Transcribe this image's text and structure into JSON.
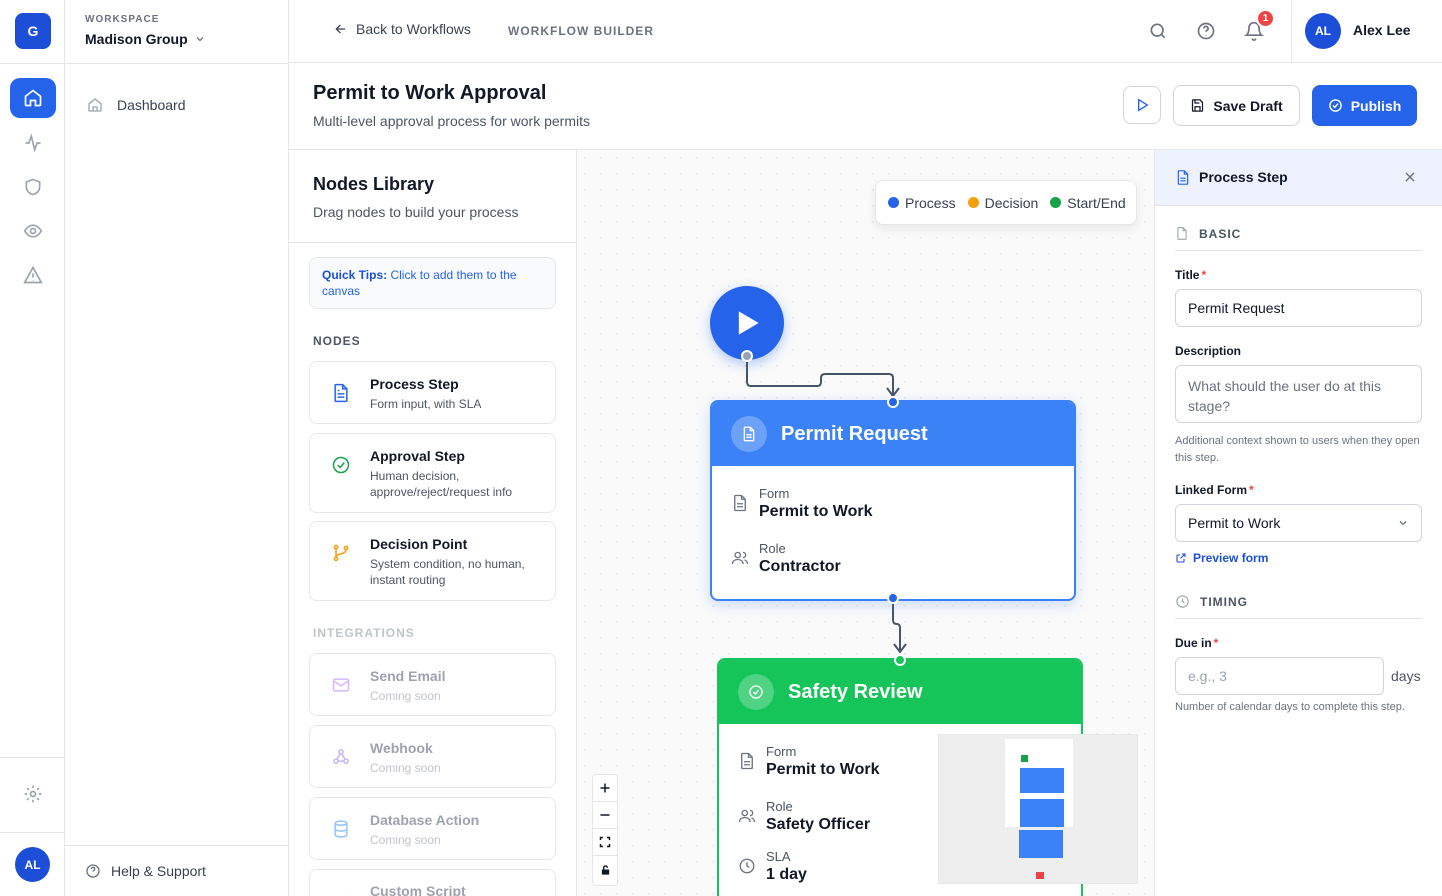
{
  "rail": {
    "logo_letter": "G",
    "avatar_initials": "AL",
    "items": [
      "home-icon",
      "activity-icon",
      "shield-icon",
      "eye-icon",
      "alert-triangle-icon"
    ],
    "settings_icon": "gear-icon"
  },
  "workspace": {
    "label": "WORKSPACE",
    "name": "Madison Group",
    "nav": [
      {
        "label": "Dashboard",
        "icon": "home-icon"
      }
    ],
    "help": "Help & Support"
  },
  "topbar": {
    "back_label": "Back to Workflows",
    "section_label": "WORKFLOW BUILDER",
    "notification_count": "1",
    "user": {
      "initials": "AL",
      "name": "Alex Lee"
    }
  },
  "header": {
    "title": "Permit to Work Approval",
    "subtitle": "Multi-level approval process for work permits",
    "save_label": "Save Draft",
    "publish_label": "Publish"
  },
  "library": {
    "title": "Nodes Library",
    "subtitle": "Drag nodes to build your process",
    "tips_title": "Quick Tips:",
    "tips_text": " Click to add them to the canvas",
    "nodes_label": "NODES",
    "nodes": [
      {
        "title": "Process Step",
        "desc": "Form input, with SLA",
        "icon": "document-icon"
      },
      {
        "title": "Approval Step",
        "desc": "Human decision, approve/reject/request info",
        "icon": "check-circle-icon"
      },
      {
        "title": "Decision Point",
        "desc": "System condition, no human, instant routing",
        "icon": "branch-icon"
      }
    ],
    "integrations_label": "INTEGRATIONS",
    "integrations": [
      {
        "title": "Send Email",
        "desc": "Coming soon",
        "icon": "mail-icon"
      },
      {
        "title": "Webhook",
        "desc": "Coming soon",
        "icon": "webhook-icon"
      },
      {
        "title": "Database Action",
        "desc": "Coming soon",
        "icon": "database-icon"
      },
      {
        "title": "Custom Script",
        "desc": "",
        "icon": "code-icon"
      }
    ]
  },
  "canvas": {
    "legend": [
      {
        "label": "Process",
        "color": "#2563eb"
      },
      {
        "label": "Decision",
        "color": "#f59e0b"
      },
      {
        "label": "Start/End",
        "color": "#16a34a"
      }
    ],
    "nodes": [
      {
        "title": "Permit Request",
        "color": "#3b82f6",
        "fields": [
          {
            "label": "Form",
            "value": "Permit to Work",
            "icon": "document-icon"
          },
          {
            "label": "Role",
            "value": "Contractor",
            "icon": "users-icon"
          }
        ]
      },
      {
        "title": "Safety Review",
        "color": "#16c55a",
        "fields": [
          {
            "label": "Form",
            "value": "Permit to Work",
            "icon": "document-icon"
          },
          {
            "label": "Role",
            "value": "Safety Officer",
            "icon": "users-icon"
          },
          {
            "label": "SLA",
            "value": "1 day",
            "icon": "clock-icon"
          }
        ]
      }
    ],
    "zoom_controls": [
      "+",
      "−",
      "fit",
      "lock"
    ]
  },
  "props": {
    "title": "Process Step",
    "basic_label": "BASIC",
    "title_label": "Title",
    "title_value": "Permit Request",
    "desc_label": "Description",
    "desc_placeholder": "What should the user do at this stage?",
    "desc_help": "Additional context shown to users when they open this step.",
    "form_label": "Linked Form",
    "form_value": "Permit to Work",
    "preview_link": "Preview form",
    "timing_label": "TIMING",
    "due_label": "Due in",
    "due_placeholder": "e.g., 3",
    "due_unit": "days",
    "due_help": "Number of calendar days to complete this step."
  }
}
